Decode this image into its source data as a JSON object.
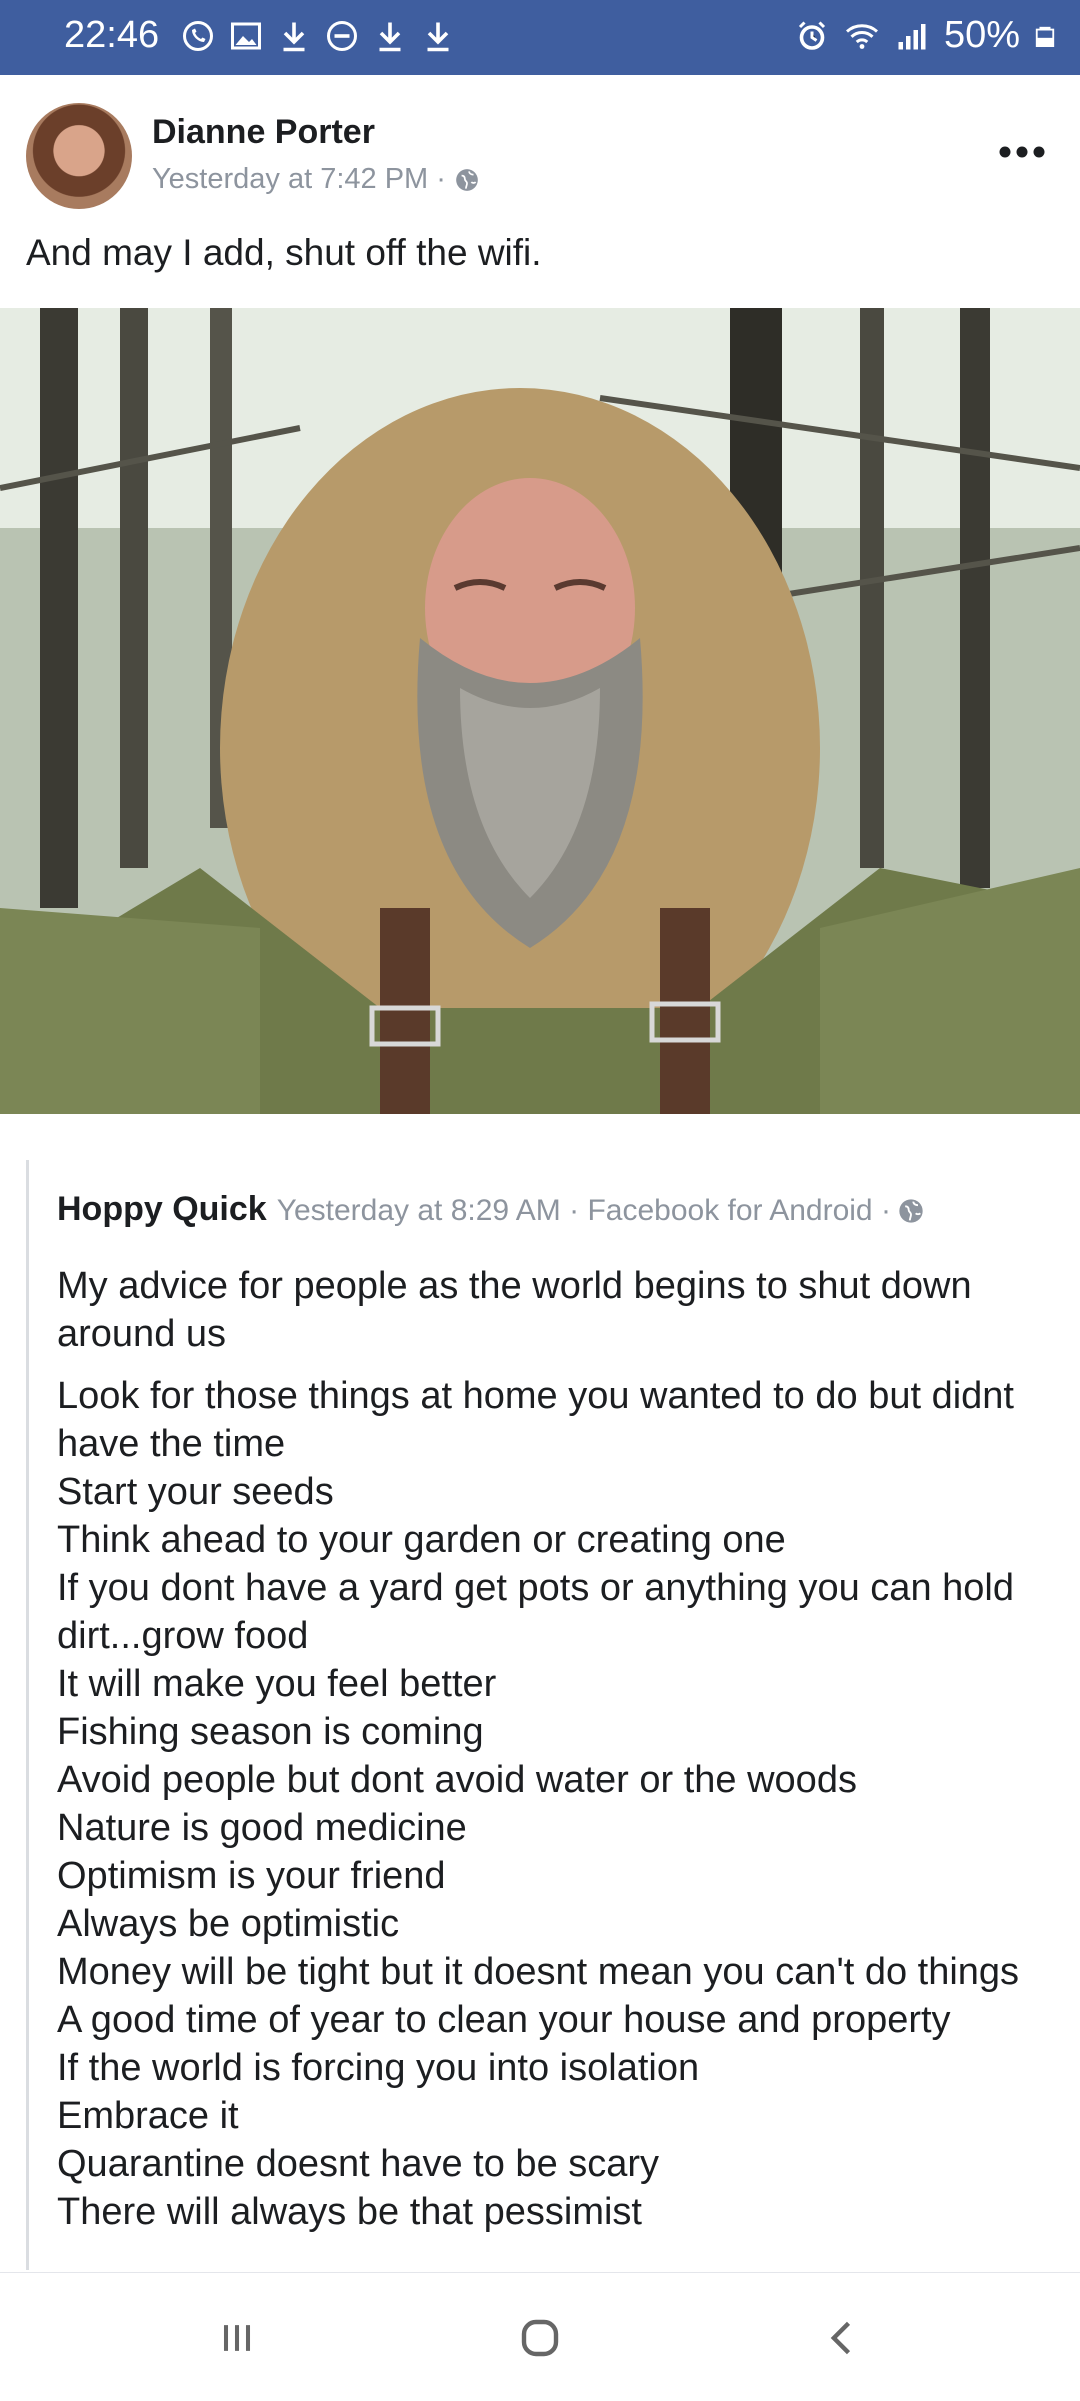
{
  "status_bar": {
    "time": "22:46",
    "battery": "50%",
    "icons_left": [
      "whatsapp-icon",
      "gallery-icon",
      "download-icon",
      "do-not-disturb-icon",
      "download-icon",
      "download-icon"
    ],
    "icons_right": [
      "alarm-icon",
      "wifi-icon",
      "signal-icon",
      "battery-icon"
    ]
  },
  "post": {
    "author": "Dianne Porter",
    "timestamp": "Yesterday at 7:42 PM",
    "separator": "·",
    "privacy_icon": "globe-icon",
    "text": "And may I add, shut off the wifi."
  },
  "shared_post": {
    "author": "Hoppy Quick",
    "meta": "Yesterday at 8:29 AM · Facebook for Android ·",
    "intro": "My advice for people as the world begins to shut down around us",
    "lines": [
      "Look for those things at home you wanted to do but didnt have the time",
      "Start your seeds",
      "Think ahead to your garden or creating one",
      "If you dont have a yard get pots or anything you can hold dirt...grow food",
      "It will make you feel better",
      "Fishing season is coming",
      "Avoid people but dont avoid water or the woods",
      "Nature is good medicine",
      "Optimism is your friend",
      "Always be optimistic",
      "Money will be tight but it doesnt mean you can't do things",
      "A good time of year to clean your house and property",
      "If the world is forcing you into isolation",
      "Embrace it",
      "Quarantine doesnt have to be scary",
      "There will always be that pessimist"
    ]
  },
  "nav": {
    "icons": [
      "recent-apps-icon",
      "home-icon",
      "back-icon"
    ]
  },
  "colors": {
    "status_bar": "#3f5e9f",
    "meta_text": "#8d949e",
    "body_text": "#1c1e21"
  }
}
